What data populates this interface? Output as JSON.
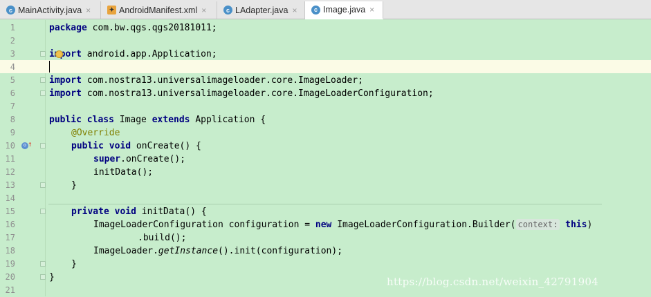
{
  "tabs": [
    {
      "label": "MainActivity.java",
      "icon": "java-class-icon",
      "active": false
    },
    {
      "label": "AndroidManifest.xml",
      "icon": "xml-file-icon",
      "active": false
    },
    {
      "label": "LAdapter.java",
      "icon": "java-class-icon",
      "active": false
    },
    {
      "label": "Image.java",
      "icon": "java-class-icon",
      "active": true
    }
  ],
  "close_glyph": "×",
  "line_numbers": [
    "1",
    "2",
    "3",
    "4",
    "5",
    "6",
    "7",
    "8",
    "9",
    "10",
    "11",
    "12",
    "13",
    "14",
    "15",
    "16",
    "17",
    "18",
    "19",
    "20",
    "21"
  ],
  "code": {
    "l1_kw": "package",
    "l1_rest": " com.bw.qgs.qgs20181011;",
    "l3_kw": "import",
    "l3_rest": " android.app.Application;",
    "l5_kw": "import",
    "l5_rest": " com.nostra13.universalimageloader.core.ImageLoader;",
    "l6_kw": "import",
    "l6_rest": " com.nostra13.universalimageloader.core.ImageLoaderConfiguration;",
    "l8_kw1": "public class",
    "l8_mid": " Image ",
    "l8_kw2": "extends",
    "l8_rest": " Application {",
    "l9_ann": "@Override",
    "l10_kw": "public void",
    "l10_rest": " onCreate() {",
    "l11_kw": "super",
    "l11_rest": ".onCreate();",
    "l12": "initData();",
    "l13": "}",
    "l15_kw": "private void",
    "l15_rest": " initData() {",
    "l16_a": "ImageLoaderConfiguration configuration = ",
    "l16_kw": "new",
    "l16_b": " ImageLoaderConfiguration.Builder(",
    "l16_hint": "context:",
    "l16_kw2": "this",
    "l16_c": ")",
    "l17": ".build();",
    "l18_a": "ImageLoader.",
    "l18_ital": "getInstance",
    "l18_b": "().init(configuration);",
    "l19": "}",
    "l20": "}"
  },
  "watermark": "https://blog.csdn.net/weixin_42791904",
  "colors": {
    "background": "#c7edcc",
    "keyword": "#000080",
    "annotation": "#808000",
    "current_line": "#fbfbe6"
  }
}
